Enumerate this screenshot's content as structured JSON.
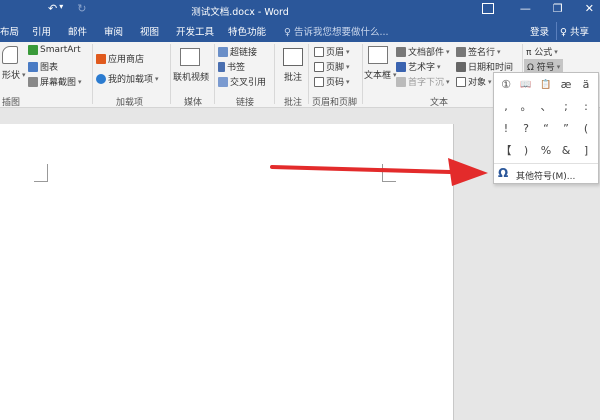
{
  "title_bar": {
    "title": "测试文档.docx - Word",
    "undo_glyph": "↶",
    "dropdown_glyph": "▾",
    "redo_glyph": "↻",
    "ribbon_display_glyph": "",
    "minimize_glyph": "—",
    "restore_glyph": "❐",
    "close_glyph": "✕"
  },
  "tabs": [
    "布局",
    "引用",
    "邮件",
    "审阅",
    "视图",
    "开发工具",
    "特色功能"
  ],
  "tell_me": "♀ 告诉我您想要做什么...",
  "login": "登录",
  "share": "♀ 共享",
  "ribbon": {
    "illustrations": {
      "shapes": "形状",
      "smartart": "SmartArt",
      "chart": "图表",
      "screenshot": "屏幕截图",
      "label": "插图"
    },
    "addins": {
      "store": "应用商店",
      "my_addins": "我的加载项",
      "label": "加载项"
    },
    "media": {
      "online_video": "联机视频",
      "label": "媒体"
    },
    "links": {
      "hyperlink": "超链接",
      "bookmark": "书签",
      "cross_ref": "交叉引用",
      "label": "链接"
    },
    "comments": {
      "comment": "批注",
      "label": "批注"
    },
    "header_footer": {
      "header": "页眉",
      "footer": "页脚",
      "page_number": "页码",
      "label": "页眉和页脚"
    },
    "text": {
      "textbox": "文本框",
      "quick_parts": "文档部件",
      "wordart": "艺术字",
      "dropcap": "首字下沉",
      "signature": "签名行",
      "datetime": "日期和时间",
      "object": "对象",
      "label": "文本"
    },
    "symbols": {
      "equation": "π 公式",
      "symbol": "Ω 符号"
    }
  },
  "symbol_dropdown": {
    "symbols": [
      [
        "①",
        "📖",
        "📋",
        "æ",
        "ä"
      ],
      [
        ",",
        "。",
        "、",
        ";",
        ":"
      ],
      [
        "!",
        "?",
        "“",
        "”",
        "("
      ],
      [
        "【",
        ")",
        "%",
        "&",
        "]"
      ]
    ],
    "more_icon": "Ω",
    "more_label": "其他符号(M)..."
  },
  "colors": {
    "accent": "#2b579a",
    "arrow": "#e32b2b"
  }
}
